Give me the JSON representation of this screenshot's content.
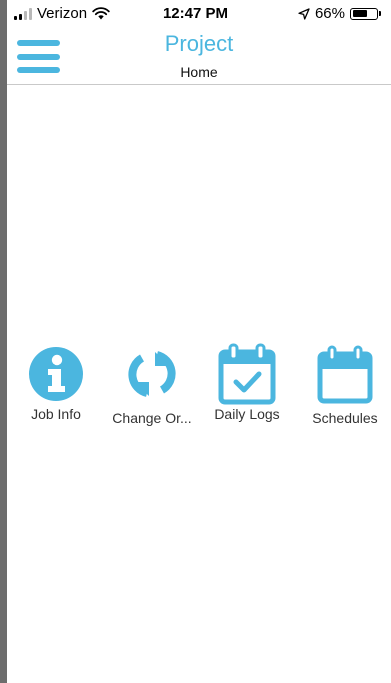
{
  "status_bar": {
    "carrier": "Verizon",
    "time": "12:47 PM",
    "battery_percent_text": "66%",
    "battery_level": 0.66,
    "signal_bars_active": 2,
    "signal_bars_total": 4
  },
  "header": {
    "title": "Project",
    "subtitle": "Home"
  },
  "tiles": [
    {
      "label": "Job Info",
      "icon": "info-icon"
    },
    {
      "label": "Change Or...",
      "icon": "refresh-icon"
    },
    {
      "label": "Daily Logs",
      "icon": "calendar-check-icon"
    },
    {
      "label": "Schedules",
      "icon": "calendar-icon"
    }
  ],
  "colors": {
    "accent": "#4bb6df"
  }
}
